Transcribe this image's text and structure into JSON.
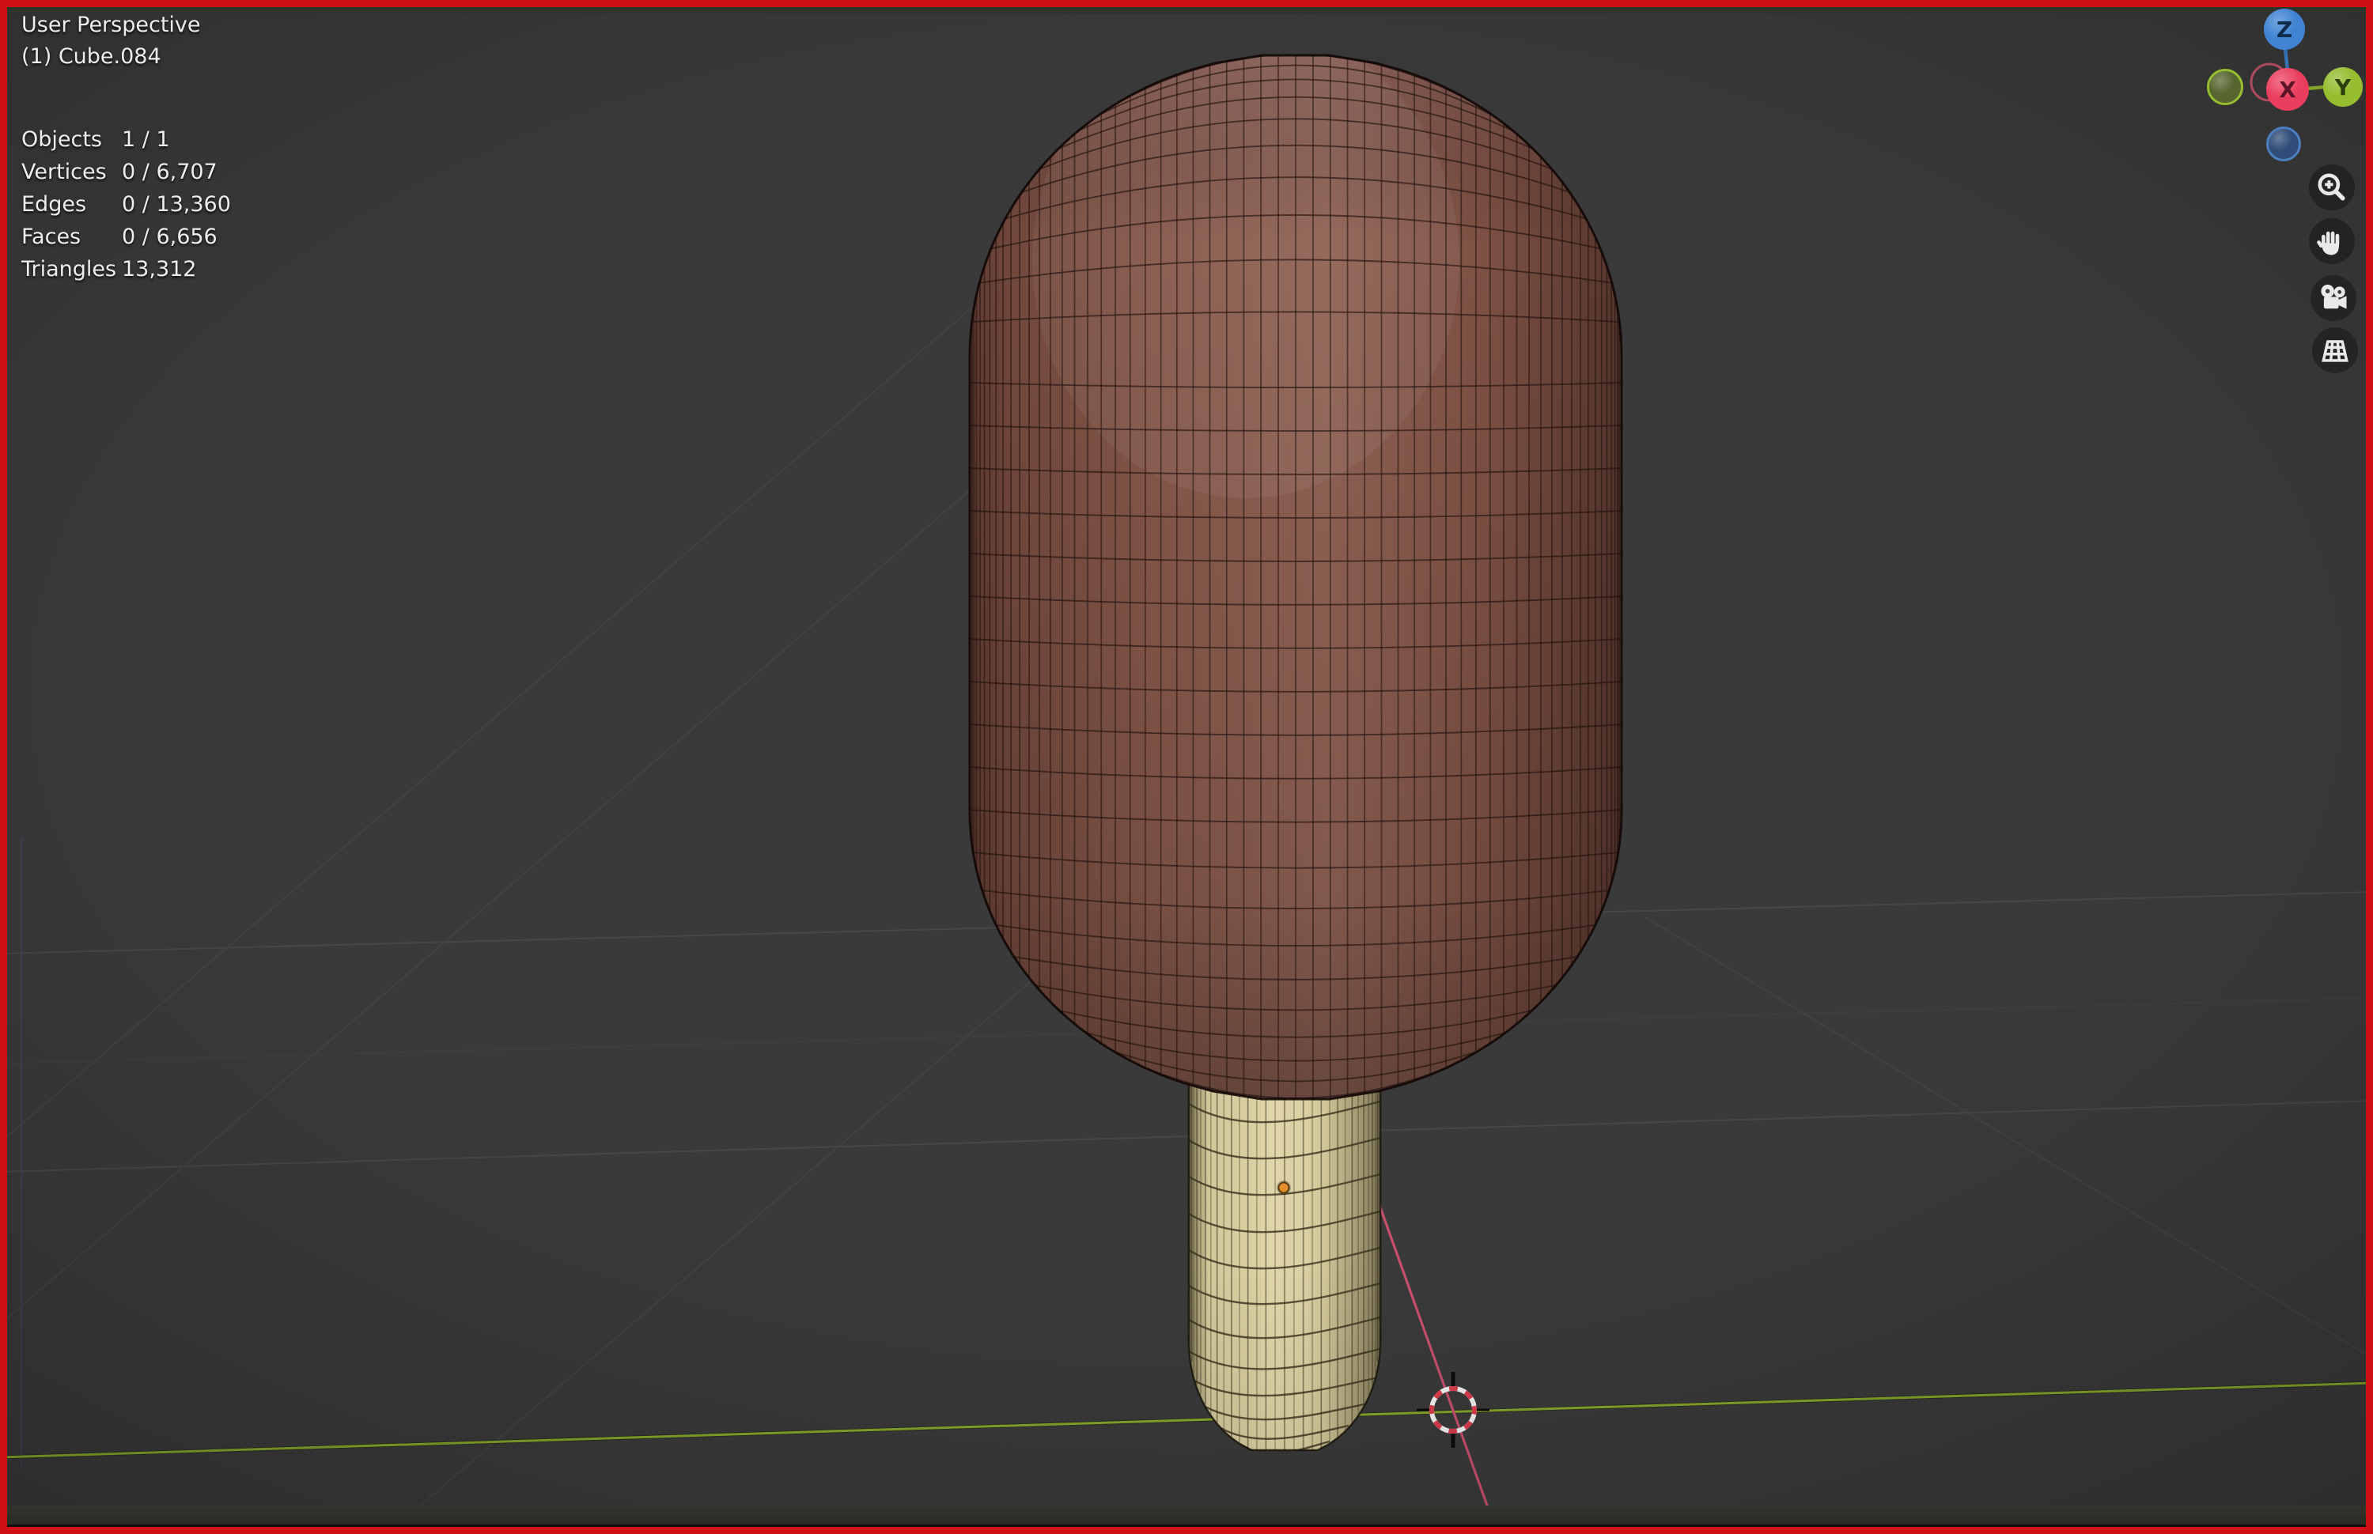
{
  "overlay": {
    "view_label": "User Perspective",
    "object_label": "(1) Cube.084",
    "stats": {
      "rows": [
        {
          "label": "Objects",
          "value": "1 / 1"
        },
        {
          "label": "Vertices",
          "value": "0 / 6,707"
        },
        {
          "label": "Edges",
          "value": "0 / 13,360"
        },
        {
          "label": "Faces",
          "value": "0 / 6,656"
        },
        {
          "label": "Triangles",
          "value": "13,312"
        }
      ]
    }
  },
  "gizmo": {
    "z": "Z",
    "x": "X",
    "y": "Y"
  },
  "nav_buttons": [
    {
      "icon": "zoom-in-magnifier"
    },
    {
      "icon": "pan-hand"
    },
    {
      "icon": "camera-view"
    },
    {
      "icon": "grid-floor"
    }
  ],
  "scene": {
    "colors": {
      "border_red": "#cf1016",
      "viewport_bg": "#3a3a3a",
      "grid_line": "#4a4a4a",
      "grid_line_faint": "#444444",
      "grid_vertical_purple": "#46405a",
      "axis_y_green": "#86a62c",
      "axis_x_pink": "#c8506e",
      "chocolate_base": "#85584a",
      "chocolate_dark": "#5e3a30",
      "chocolate_light": "#906355",
      "chocolate_wire": "#241310",
      "stick_base": "#d2c89a",
      "stick_dark": "#7e7656",
      "stick_wire": "#37311d",
      "origin_dot": "#e38f2b",
      "origin_dot_edge": "#5c3a10",
      "cursor_red": "#da3d4c",
      "cursor_white": "#f2f2f2",
      "cursor_tick": "#0c0c0c",
      "gizmo_z_ball": "#3f83d2",
      "gizmo_x_ball": "#ea3e5e",
      "gizmo_y_ball": "#95bd2f",
      "gizmo_neg_y_fill": "#57652f",
      "gizmo_neg_z_fill": "#2f4d78",
      "gizmo_neg_z_edge": "#4d7fc0",
      "gizmo_z_letter": "#102c4a",
      "gizmo_x_letter": "#5c1526",
      "gizmo_y_letter": "#2c3f0d",
      "icon_fg": "#e9e9e9",
      "hud_text": "#ededed"
    }
  }
}
